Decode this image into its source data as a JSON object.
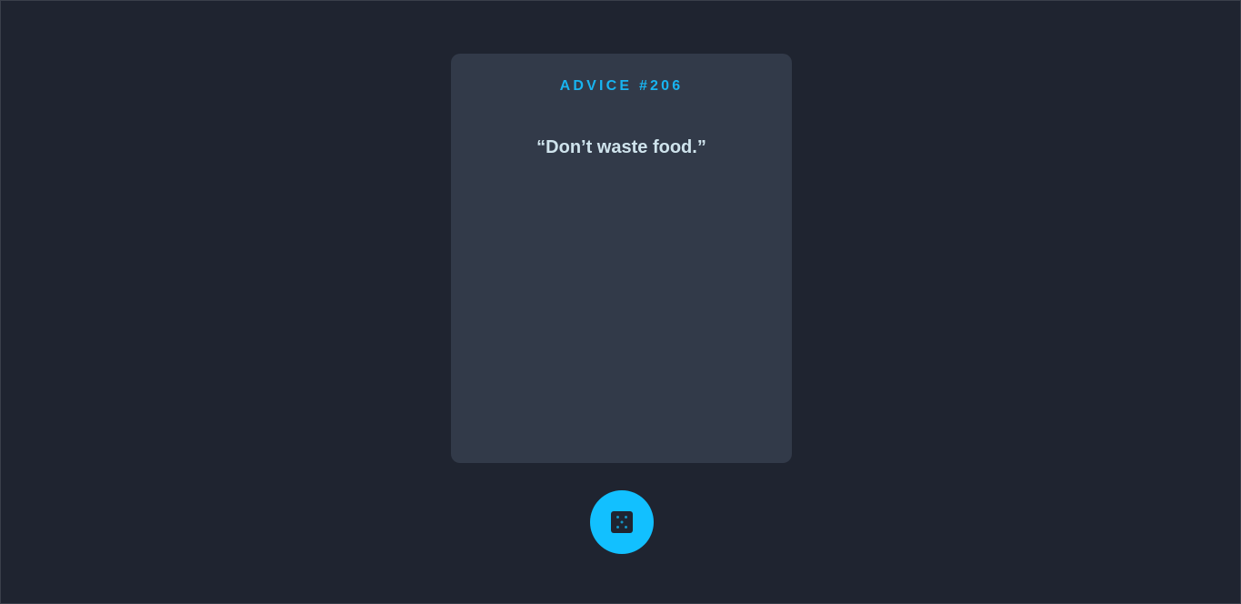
{
  "advice": {
    "id_label": "ADVICE #206",
    "text": "“Don’t waste food.”"
  },
  "button": {
    "icon": "dice-icon",
    "accent_color": "#12c0ff"
  },
  "colors": {
    "background": "#1f2430",
    "card": "#323a49",
    "accent": "#18b4f0",
    "text": "#cfe3ec"
  }
}
